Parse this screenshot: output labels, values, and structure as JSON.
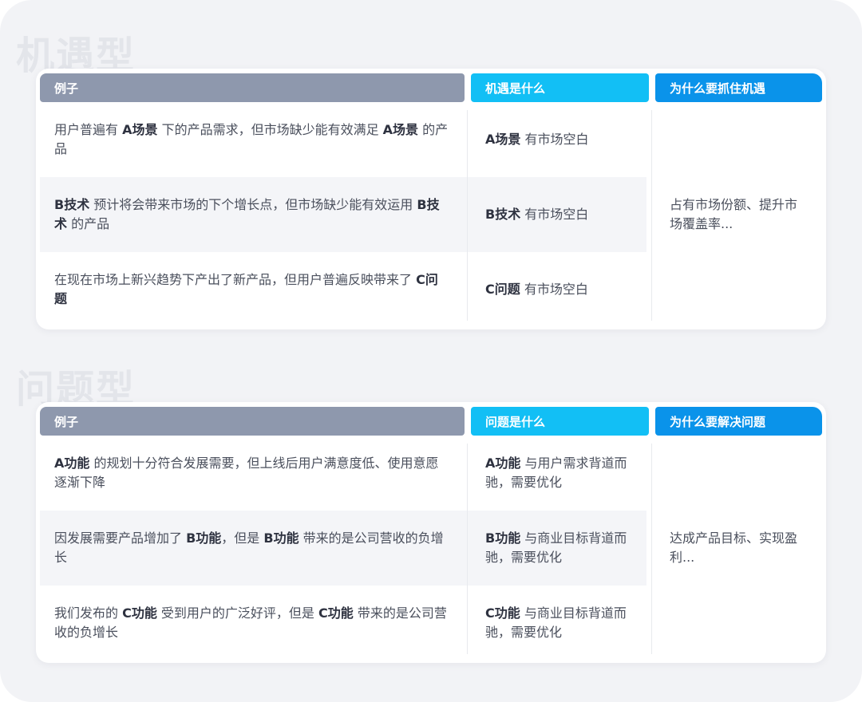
{
  "sections": [
    {
      "title": "机遇型",
      "headers": [
        "例子",
        "机遇是什么",
        "为什么要抓住机遇"
      ],
      "rows": [
        {
          "example": [
            {
              "t": "用户普遍有 "
            },
            {
              "t": "A场景",
              "b": true
            },
            {
              "t": " 下的产品需求，但市场缺少能有效满足 "
            },
            {
              "t": "A场景",
              "b": true
            },
            {
              "t": " 的产品"
            }
          ],
          "what": [
            {
              "t": "A场景",
              "b": true
            },
            {
              "t": " 有市场空白"
            }
          ]
        },
        {
          "example": [
            {
              "t": "B技术",
              "b": true
            },
            {
              "t": " 预计将会带来市场的下个增长点，但市场缺少能有效运用 "
            },
            {
              "t": "B技术",
              "b": true
            },
            {
              "t": " 的产品"
            }
          ],
          "what": [
            {
              "t": "B技术",
              "b": true
            },
            {
              "t": " 有市场空白"
            }
          ]
        },
        {
          "example": [
            {
              "t": "在现在市场上新兴趋势下产出了新产品，但用户普遍反映带来了 "
            },
            {
              "t": "C问题",
              "b": true
            }
          ],
          "what": [
            {
              "t": "C问题",
              "b": true
            },
            {
              "t": " 有市场空白"
            }
          ]
        }
      ],
      "why": "占有市场份额、提升市场覆盖率..."
    },
    {
      "title": "问题型",
      "headers": [
        "例子",
        "问题是什么",
        "为什么要解决问题"
      ],
      "rows": [
        {
          "example": [
            {
              "t": "A功能",
              "b": true
            },
            {
              "t": " 的规划十分符合发展需要，但上线后用户满意度低、使用意愿逐渐下降"
            }
          ],
          "what": [
            {
              "t": "A功能",
              "b": true
            },
            {
              "t": " 与用户需求背道而驰，需要优化"
            }
          ]
        },
        {
          "example": [
            {
              "t": "因发展需要产品增加了 "
            },
            {
              "t": "B功能",
              "b": true
            },
            {
              "t": "，但是 "
            },
            {
              "t": "B功能",
              "b": true
            },
            {
              "t": " 带来的是公司营收的负增长"
            }
          ],
          "what": [
            {
              "t": "B功能",
              "b": true
            },
            {
              "t": " 与商业目标背道而驰，需要优化"
            }
          ]
        },
        {
          "example": [
            {
              "t": "我们发布的 "
            },
            {
              "t": "C功能",
              "b": true
            },
            {
              "t": " 受到用户的广泛好评，但是 "
            },
            {
              "t": "C功能",
              "b": true
            },
            {
              "t": " 带来的是公司营收的负增长"
            }
          ],
          "what": [
            {
              "t": "C功能",
              "b": true
            },
            {
              "t": " 与商业目标背道而驰，需要优化"
            }
          ]
        }
      ],
      "why": "达成产品目标、实现盈利..."
    }
  ],
  "colors": {
    "header_example": "#8e98ad",
    "header_what": "#12bff5",
    "header_why": "#0a93ea",
    "row_alt": "#f4f5f8",
    "background": "#f2f3f6"
  }
}
